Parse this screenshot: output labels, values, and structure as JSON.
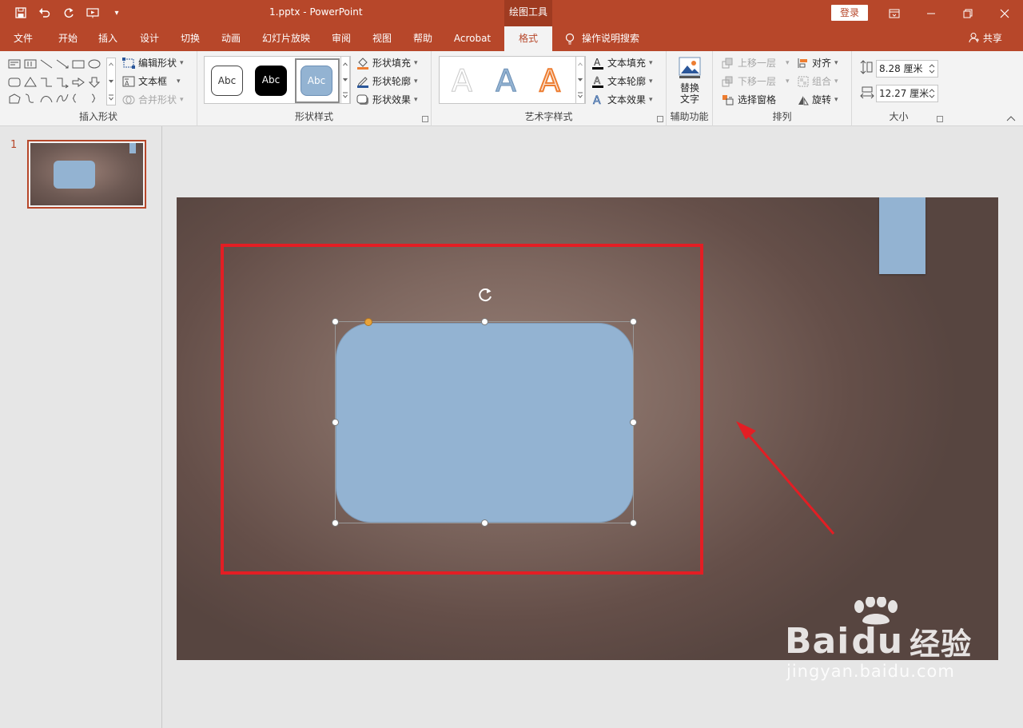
{
  "title_bar": {
    "doc_title": "1.pptx  -  PowerPoint",
    "context_tab": "绘图工具",
    "login": "登录"
  },
  "tabs": [
    "文件",
    "开始",
    "插入",
    "设计",
    "切换",
    "动画",
    "幻灯片放映",
    "审阅",
    "视图",
    "帮助",
    "Acrobat",
    "格式"
  ],
  "active_tab": "格式",
  "search_label": "操作说明搜索",
  "share_label": "共享",
  "ribbon": {
    "insert_shapes": {
      "edit_shape": "编辑形状",
      "text_box": "文本框",
      "merge_shapes": "合并形状",
      "label": "插入形状"
    },
    "shape_styles": {
      "preset_text": "Abc",
      "fill": "形状填充",
      "outline": "形状轮廓",
      "effects": "形状效果",
      "label": "形状样式"
    },
    "wordart_styles": {
      "letter": "A",
      "text_fill": "文本填充",
      "text_outline": "文本轮廓",
      "text_effects": "文本效果",
      "label": "艺术字样式"
    },
    "accessibility": {
      "alt_text_line1": "替换",
      "alt_text_line2": "文字",
      "label": "辅助功能"
    },
    "arrange": {
      "bring_forward": "上移一层",
      "send_backward": "下移一层",
      "selection_pane": "选择窗格",
      "align": "对齐",
      "group": "组合",
      "rotate": "旋转",
      "label": "排列"
    },
    "size": {
      "height": "8.28 厘米",
      "width": "12.27 厘米",
      "label": "大小"
    }
  },
  "slides": [
    {
      "number": "1"
    }
  ],
  "watermark": {
    "brand": "Bai",
    "brand_suffix": "du",
    "product": "经验",
    "url": "jingyan.baidu.com"
  },
  "colors": {
    "accent": "#b7472a",
    "shape_fill": "#93b3d2",
    "highlight_box": "#e31e24"
  }
}
